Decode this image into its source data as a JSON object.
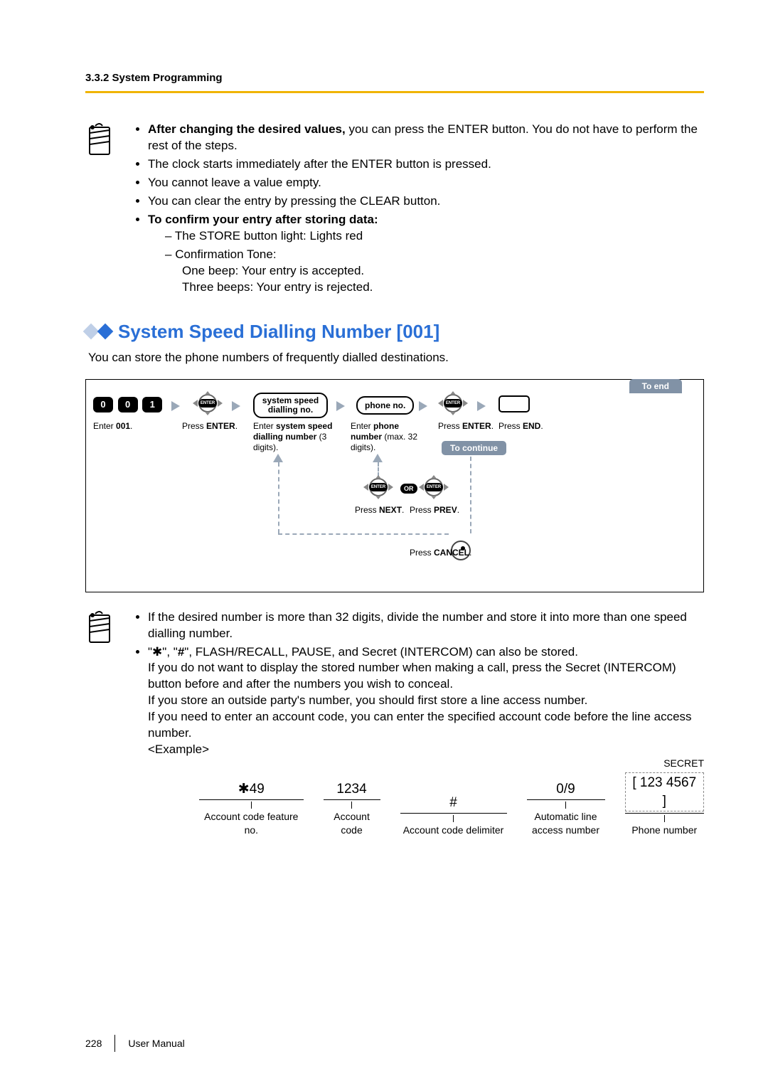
{
  "header": {
    "section_label": "3.3.2 System Programming"
  },
  "note1": {
    "b1_bold": "After changing the desired values,",
    "b1_rest": " you can press the ENTER button. You do not have to perform the rest of the steps.",
    "b2": "The clock starts immediately after the ENTER button is pressed.",
    "b3": "You cannot leave a value empty.",
    "b4": "You can clear the entry by pressing the CLEAR button.",
    "b5": "To confirm your entry after storing data:",
    "s1": "The STORE button light: Lights red",
    "s2": "Confirmation Tone:",
    "s2a": "One beep: Your entry is accepted.",
    "s2b": "Three beeps: Your entry is rejected."
  },
  "section": {
    "title": "System Speed Dialling Number [001]",
    "intro": "You can store the phone numbers of frequently dialled destinations."
  },
  "flow": {
    "digits": [
      "0",
      "0",
      "1"
    ],
    "box_sys": "system speed dialling no.",
    "box_phone": "phone no.",
    "to_end": "To end",
    "to_continue": "To continue",
    "cap_enter001_pre": "Enter ",
    "cap_enter001_bold": "001",
    "cap_enter001_post": ".",
    "cap_press_enter_pre": "Press ",
    "cap_press_enter_bold": "ENTER",
    "cap_press_enter_post": ".",
    "cap_sys_pre": "Enter ",
    "cap_sys_bold": "system speed dialling number",
    "cap_sys_post": " (3 digits).",
    "cap_phone_pre": "Enter ",
    "cap_phone_bold": "phone number",
    "cap_phone_post": " (max. 32 digits).",
    "cap_press_end_pre": "Press ",
    "cap_press_end_bold": "END",
    "cap_press_end_post": ".",
    "cap_press_next_pre": "Press ",
    "cap_press_next_bold": "NEXT",
    "cap_press_next_post": ".",
    "cap_press_prev_pre": "Press ",
    "cap_press_prev_bold": "PREV",
    "cap_press_prev_post": ".",
    "cap_press_cancel_pre": "Press ",
    "cap_press_cancel_bold": "CANCEL",
    "cap_press_cancel_post": ".",
    "or": "OR",
    "enter_label": "ENTER"
  },
  "note2": {
    "b1": "If the desired number is more than 32 digits, divide the number and store it into more than one speed dialling number.",
    "b2_a": "\"",
    "b2_star": "✱",
    "b2_b": "\", \"",
    "b2_hash": "#",
    "b2_c": "\", FLASH/RECALL, PAUSE, and Secret (INTERCOM) can also be stored.",
    "b2_l2": "If you do not want to display the stored number when making a call, press the Secret (INTERCOM) button before and after the numbers you wish to conceal.",
    "b2_l3": "If you store an outside party's number, you should first store a line access number.",
    "b2_l4": "If you need to enter an account code, you can enter the specified account code before the line access number.",
    "b2_ex": "<Example>"
  },
  "example": {
    "c1": {
      "val_pre": "✱",
      "val": "49",
      "label": "Account code feature no."
    },
    "c2": {
      "val": "1234",
      "label": "Account code"
    },
    "c3": {
      "val": "#",
      "label": "Account code delimiter"
    },
    "c4": {
      "val": "0/9",
      "label": "Automatic line access number"
    },
    "c5": {
      "val": "123 4567",
      "label": "Phone number",
      "secret": "SECRET"
    }
  },
  "footer": {
    "page": "228",
    "manual": "User Manual"
  }
}
